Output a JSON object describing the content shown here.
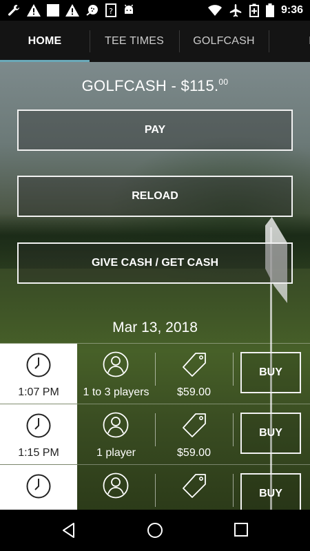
{
  "status_bar": {
    "time": "9:36",
    "left_icons": [
      "wrench-icon",
      "warning-icon",
      "blank-notification-icon",
      "warning-icon",
      "golf-app-icon",
      "unknown-file-icon",
      "android-icon"
    ],
    "right_icons": [
      "wifi-icon",
      "airplane-mode-icon",
      "battery-saver-icon",
      "battery-icon"
    ]
  },
  "tabs": [
    {
      "label": "HOME",
      "active": true
    },
    {
      "label": "TEE TIMES",
      "active": false
    },
    {
      "label": "GOLFCASH",
      "active": false
    },
    {
      "label": "M",
      "active": false
    }
  ],
  "balance": {
    "prefix": "GOLFCASH - $115.",
    "cents": "00"
  },
  "actions": {
    "pay": "PAY",
    "reload": "RELOAD",
    "give_get": "GIVE CASH / GET CASH"
  },
  "date": "Mar 13, 2018",
  "tee_times": [
    {
      "time": "1:07 PM",
      "players": "1 to 3 players",
      "price": "$59.00",
      "buy": "BUY"
    },
    {
      "time": "1:15 PM",
      "players": "1 player",
      "price": "$59.00",
      "buy": "BUY"
    },
    {
      "time": "",
      "players": "",
      "price": "",
      "buy": "BUY"
    }
  ],
  "colors": {
    "tab_indicator": "#6aa9b9",
    "tab_bar": "#141414",
    "button_border": "#f2f2f2"
  }
}
